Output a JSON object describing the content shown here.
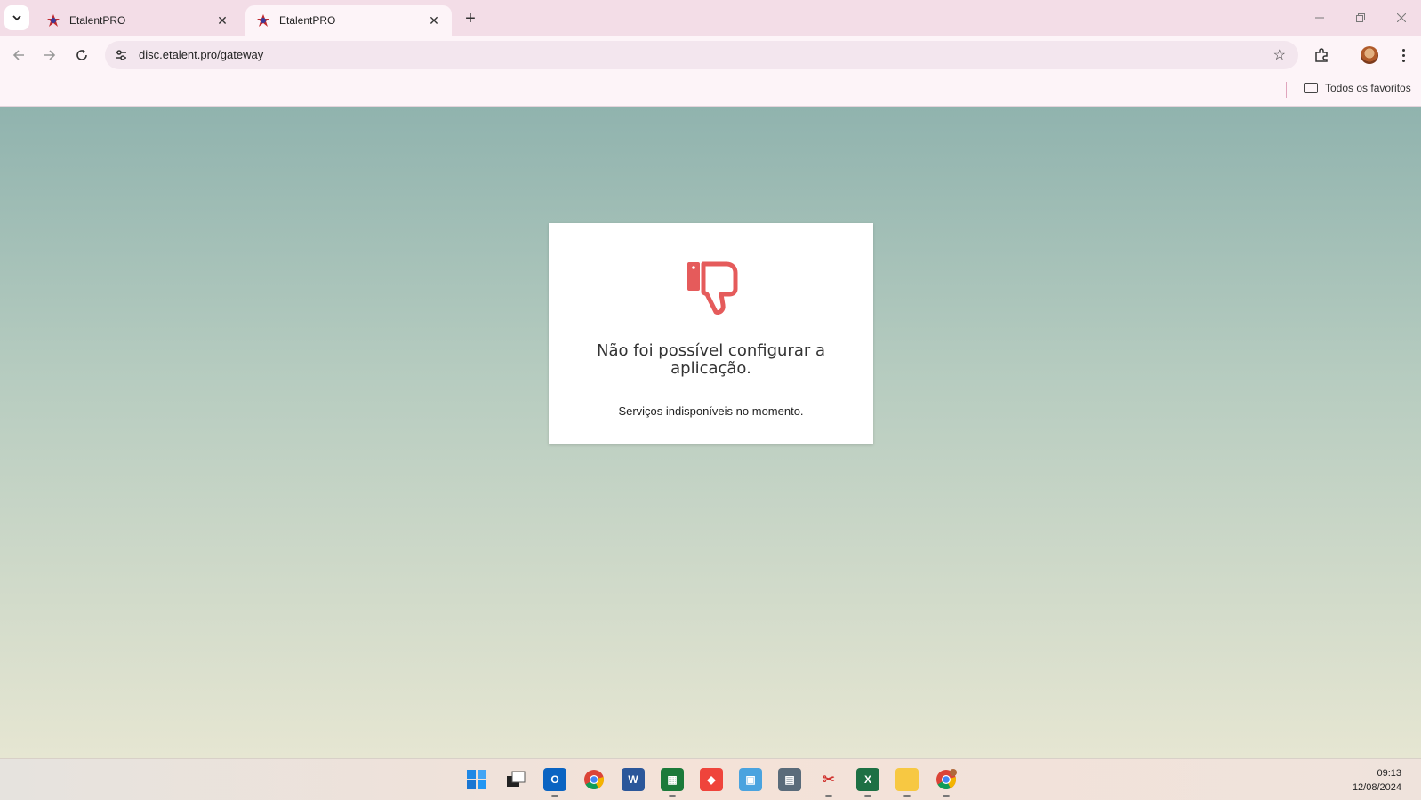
{
  "browser": {
    "tabs": [
      {
        "title": "EtalentPRO",
        "active": false
      },
      {
        "title": "EtalentPRO",
        "active": true
      }
    ],
    "url": "disc.etalent.pro/gateway",
    "bookmarks_all_label": "Todos os favoritos"
  },
  "page": {
    "background_top": "#90b3ae",
    "background_bottom": "#e6e6d2",
    "card": {
      "icon": "thumbs-down-icon",
      "icon_color": "#e55b5b",
      "title": "Não foi possível configurar a aplicação.",
      "subtitle": "Serviços indisponíveis no momento."
    }
  },
  "taskbar": {
    "apps": [
      "windows-start",
      "task-view",
      "outlook",
      "chrome",
      "word",
      "green-app",
      "anydesk",
      "control-panel",
      "calculator",
      "snipping-tool",
      "excel",
      "file-explorer",
      "chrome-profile"
    ],
    "time": "09:13",
    "date": "12/08/2024"
  }
}
